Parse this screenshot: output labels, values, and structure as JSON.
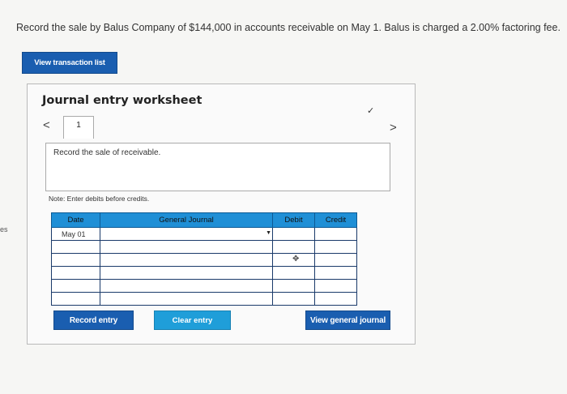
{
  "question": {
    "text": "Record the sale by Balus Company of $144,000 in accounts receivable on May 1. Balus is charged a 2.00% factoring fee."
  },
  "side_tag": "es",
  "buttons": {
    "view_transaction_list": "View transaction list",
    "record_entry": "Record entry",
    "clear_entry": "Clear entry",
    "view_general_journal": "View general journal"
  },
  "worksheet": {
    "title": "Journal entry worksheet",
    "prev_label": "<",
    "next_label": ">",
    "tab_label": "1",
    "description": "Record the sale of receivable.",
    "note": "Note: Enter debits before credits.",
    "columns": {
      "date": "Date",
      "account": "General Journal",
      "debit": "Debit",
      "credit": "Credit"
    },
    "rows": [
      {
        "date": "May 01",
        "account": "",
        "debit": "",
        "credit": ""
      },
      {
        "date": "",
        "account": "",
        "debit": "",
        "credit": ""
      },
      {
        "date": "",
        "account": "",
        "debit": "",
        "credit": ""
      },
      {
        "date": "",
        "account": "",
        "debit": "",
        "credit": ""
      },
      {
        "date": "",
        "account": "",
        "debit": "",
        "credit": ""
      },
      {
        "date": "",
        "account": "",
        "debit": "",
        "credit": ""
      }
    ]
  },
  "colors": {
    "primary_button": "#1a5eb0",
    "header_blue": "#1f8fd6",
    "accent_button": "#1f9ed9"
  },
  "icons": {
    "prev": "chevron-left-icon",
    "next": "chevron-right-icon",
    "check": "checkmark-icon",
    "dropdown": "dropdown-arrow-icon"
  }
}
